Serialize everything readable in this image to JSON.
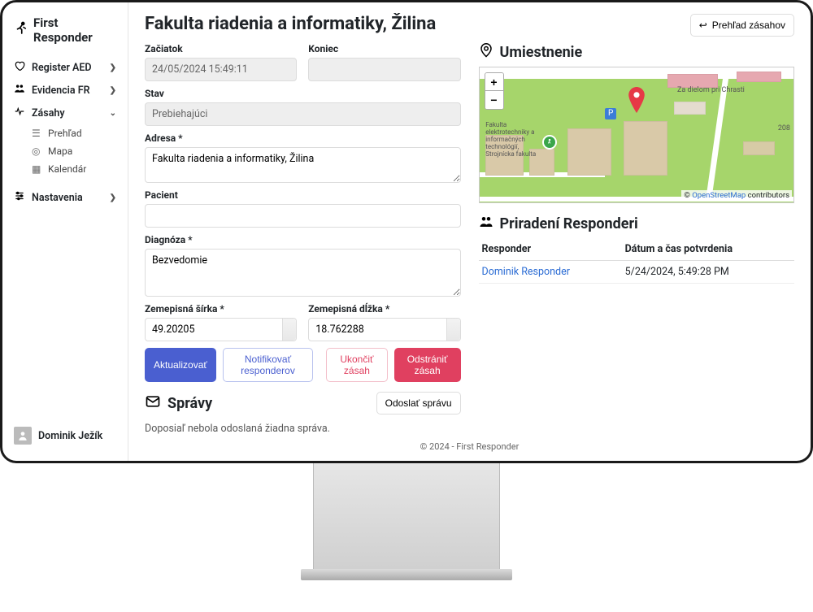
{
  "brand": "First Responder",
  "nav": {
    "register_aed": "Register AED",
    "evidencia_fr": "Evidencia FR",
    "zasahy": "Zásahy",
    "sub": {
      "prehlad": "Prehľad",
      "mapa": "Mapa",
      "kalendar": "Kalendár"
    },
    "nastavenia": "Nastavenia"
  },
  "user": {
    "name": "Dominik Ježík"
  },
  "header": {
    "title": "Fakulta riadenia a informatiky, Žilina",
    "overview_btn": "Prehľad zásahov"
  },
  "form": {
    "labels": {
      "zaciatok": "Začiatok",
      "koniec": "Koniec",
      "stav": "Stav",
      "adresa": "Adresa *",
      "pacient": "Pacient",
      "diagnoza": "Diagnóza *",
      "sirka": "Zemepisná šírka *",
      "dlzka": "Zemepisná dĺžka *"
    },
    "values": {
      "zaciatok": "24/05/2024 15:49:11",
      "koniec": "",
      "stav": "Prebiehajúci",
      "adresa": "Fakulta riadenia a informatiky, Žilina",
      "pacient": "",
      "diagnoza": "Bezvedomie",
      "sirka": "49.20205",
      "dlzka": "18.762288"
    },
    "buttons": {
      "aktualizovat": "Aktualizovať",
      "notifikovat": "Notifikovať responderov",
      "ukoncit": "Ukončiť zásah",
      "odstranit": "Odstrániť zásah"
    }
  },
  "messages": {
    "title": "Správy",
    "send_btn": "Odoslať správu",
    "empty": "Doposiaľ nebola odoslaná žiadna správa."
  },
  "location": {
    "title": "Umiestnenie",
    "attr_prefix": "© ",
    "attr_link": "OpenStreetMap",
    "attr_suffix": " contributors",
    "labels": {
      "za_dielom": "Za dielom pri Chrasti",
      "fakulta": "Fakulta elektrotechniky a informačných technológií, Strojnícka fakulta",
      "num": "208"
    }
  },
  "responders": {
    "title": "Priradení Responderi",
    "col_responder": "Responder",
    "col_datetime": "Dátum a čas potvrdenia",
    "rows": [
      {
        "name": "Dominik Responder",
        "dt": "5/24/2024, 5:49:28 PM"
      }
    ]
  },
  "footer": "© 2024 - First Responder"
}
